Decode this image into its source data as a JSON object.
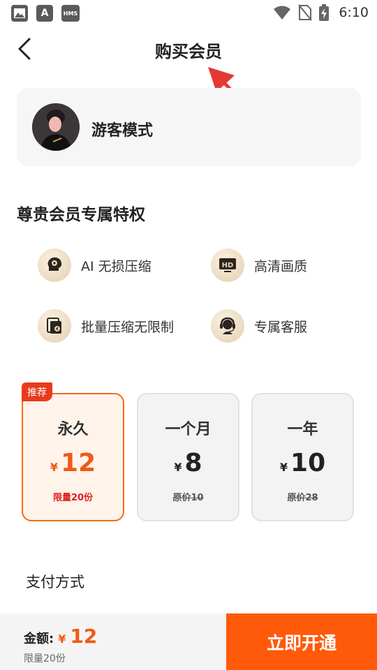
{
  "status_bar": {
    "time": "6:10",
    "left_icons": [
      "image-icon",
      "a-icon",
      "hms-icon"
    ],
    "a_text": "A",
    "hms_text": "HMS",
    "right_icons": [
      "wifi-icon",
      "no-sim-icon",
      "battery-charging-icon"
    ]
  },
  "nav": {
    "title": "购买会员",
    "back_icon": "chevron-left-icon"
  },
  "profile": {
    "name": "游客模式",
    "avatar_icon": "avatar"
  },
  "privileges": {
    "title": "尊贵会员专属特权",
    "items": [
      {
        "icon": "ai-brain-icon",
        "label": "AI 无损压缩"
      },
      {
        "icon": "hd-icon",
        "label": "高清画质"
      },
      {
        "icon": "batch-compress-icon",
        "label": "批量压缩无限制"
      },
      {
        "icon": "customer-service-icon",
        "label": "专属客服"
      }
    ]
  },
  "plans": {
    "tag": "推荐",
    "currency": "¥",
    "items": [
      {
        "name": "永久",
        "price": "12",
        "note": "限量20份",
        "selected": true
      },
      {
        "name": "一个月",
        "price": "8",
        "note": "原价10",
        "selected": false
      },
      {
        "name": "一年",
        "price": "10",
        "note": "原价28",
        "selected": false
      }
    ]
  },
  "payment": {
    "title": "支付方式"
  },
  "bottom": {
    "amount_label": "金额:",
    "currency": "¥",
    "amount": "12",
    "note": "限量20份",
    "button": "立即开通"
  },
  "colors": {
    "accent": "#ff5a0a",
    "price": "#f05a14",
    "tag": "#e83c1c",
    "selected_bg": "#fff3ea"
  }
}
